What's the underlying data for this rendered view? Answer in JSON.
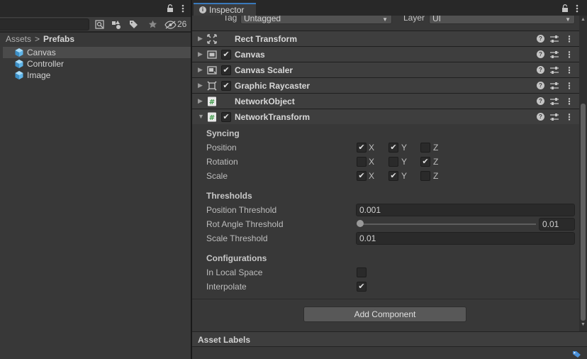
{
  "project": {
    "hidden_count": "26",
    "breadcrumb": [
      "Assets",
      "Prefabs"
    ],
    "breadcrumb_separator": ">",
    "items": [
      {
        "label": "Canvas",
        "selected": true
      },
      {
        "label": "Controller",
        "selected": false
      },
      {
        "label": "Image",
        "selected": false
      }
    ]
  },
  "inspector": {
    "tab_label": "Inspector",
    "tag_label": "Tag",
    "tag_value": "Untagged",
    "layer_label": "Layer",
    "layer_value": "UI",
    "components": [
      {
        "name": "Rect Transform",
        "icon": "rect-transform-icon",
        "has_toggle": false,
        "expanded": false
      },
      {
        "name": "Canvas",
        "icon": "canvas-icon",
        "has_toggle": true,
        "enabled": true,
        "expanded": false
      },
      {
        "name": "Canvas Scaler",
        "icon": "canvas-scaler-icon",
        "has_toggle": true,
        "enabled": true,
        "expanded": false
      },
      {
        "name": "Graphic Raycaster",
        "icon": "graphic-raycaster-icon",
        "has_toggle": true,
        "enabled": true,
        "expanded": false
      },
      {
        "name": "NetworkObject",
        "icon": "script-icon",
        "has_toggle": false,
        "expanded": false
      },
      {
        "name": "NetworkTransform",
        "icon": "script-icon",
        "has_toggle": true,
        "enabled": true,
        "expanded": true
      }
    ],
    "network_transform": {
      "syncing_header": "Syncing",
      "axes": [
        "X",
        "Y",
        "Z"
      ],
      "position": {
        "label": "Position",
        "x": true,
        "y": true,
        "z": false
      },
      "rotation": {
        "label": "Rotation",
        "x": false,
        "y": false,
        "z": true
      },
      "scale": {
        "label": "Scale",
        "x": true,
        "y": true,
        "z": false
      },
      "thresholds_header": "Thresholds",
      "position_threshold": {
        "label": "Position Threshold",
        "value": "0.001"
      },
      "rot_angle_threshold": {
        "label": "Rot Angle Threshold",
        "value": "0.01"
      },
      "scale_threshold": {
        "label": "Scale Threshold",
        "value": "0.01"
      },
      "configurations_header": "Configurations",
      "in_local_space": {
        "label": "In Local Space",
        "value": false
      },
      "interpolate": {
        "label": "Interpolate",
        "value": true
      }
    },
    "add_component_label": "Add Component",
    "asset_labels_title": "Asset Labels"
  },
  "colors": {
    "accent": "#3a79bb",
    "panel": "#383838",
    "header": "#3e3e3e",
    "field": "#2a2a2a",
    "cube": "#5fb4e8",
    "script_icon": "#3f9b4a"
  }
}
